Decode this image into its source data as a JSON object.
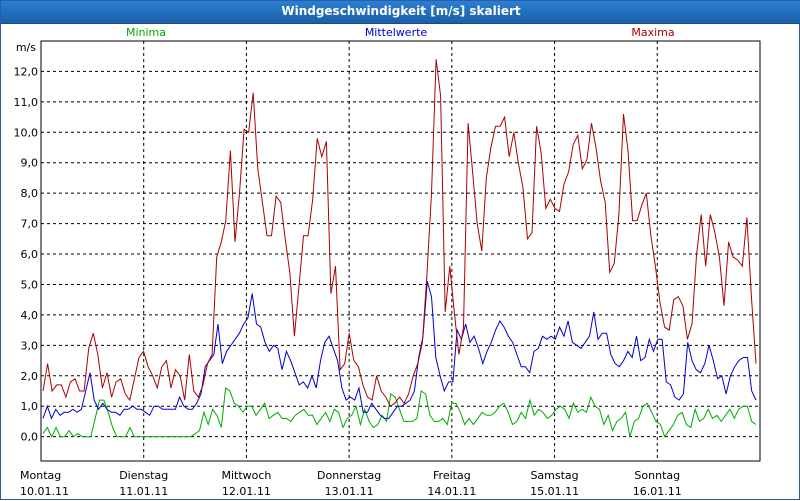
{
  "window": {
    "title": "Windgeschwindigkeit [m/s] skaliert"
  },
  "chart_data": {
    "type": "line",
    "title": "Windgeschwindigkeit [m/s] skaliert",
    "ylabel": "m/s",
    "ylim": [
      -0.8,
      13.0
    ],
    "y_ticks": [
      "0,0",
      "1,0",
      "2,0",
      "3,0",
      "4,0",
      "5,0",
      "6,0",
      "7,0",
      "8,0",
      "9,0",
      "10,0",
      "11,0",
      "12,0"
    ],
    "days": [
      {
        "name": "Montag",
        "date": "10.01.11"
      },
      {
        "name": "Dienstag",
        "date": "11.01.11"
      },
      {
        "name": "Mittwoch",
        "date": "12.01.11"
      },
      {
        "name": "Donnerstag",
        "date": "13.01.11"
      },
      {
        "name": "Freitag",
        "date": "14.01.11"
      },
      {
        "name": "Samstag",
        "date": "15.01.11"
      },
      {
        "name": "Sonntag",
        "date": "16.01.11"
      }
    ],
    "grid": true,
    "legend_position": "top",
    "series": [
      {
        "name": "Minima",
        "color": "#00aa00",
        "values": [
          0.1,
          0.3,
          0.0,
          0.3,
          0.0,
          0.0,
          0.2,
          0.0,
          0.1,
          0.0,
          0.0,
          0.0,
          0.6,
          1.2,
          1.2,
          0.8,
          0.3,
          0.0,
          0.0,
          0.0,
          0.3,
          0.0,
          0.0,
          0.0,
          0.0,
          0.0,
          0.0,
          0.0,
          0.0,
          0.0,
          0.0,
          0.0,
          0.0,
          0.0,
          0.0,
          0.1,
          0.2,
          0.8,
          0.4,
          0.9,
          0.7,
          0.3,
          1.6,
          1.5,
          1.1,
          1.0,
          0.8,
          1.0,
          1.0,
          0.7,
          0.9,
          1.1,
          0.6,
          0.7,
          0.8,
          0.6,
          0.6,
          0.5,
          0.7,
          0.8,
          0.9,
          0.7,
          0.7,
          0.4,
          0.6,
          0.8,
          0.5,
          0.9,
          0.8,
          0.3,
          0.6,
          0.7,
          1.0,
          0.4,
          0.9,
          0.5,
          0.3,
          0.4,
          0.7,
          0.5,
          1.4,
          1.3,
          0.9,
          0.5,
          0.5,
          0.5,
          0.6,
          1.5,
          1.4,
          0.7,
          0.5,
          0.5,
          0.6,
          0.4,
          1.1,
          1.1,
          0.8,
          0.4,
          0.6,
          0.4,
          0.6,
          0.8,
          0.7,
          0.7,
          0.8,
          1.0,
          1.1,
          0.8,
          0.4,
          0.5,
          0.8,
          0.6,
          1.2,
          0.7,
          0.9,
          0.8,
          0.6,
          0.7,
          0.9,
          1.0,
          0.9,
          0.6,
          1.1,
          0.8,
          0.9,
          0.8,
          1.3,
          1.0,
          0.9,
          0.4,
          0.7,
          0.2,
          0.5,
          0.6,
          0.8,
          0.0,
          0.5,
          0.6,
          1.0,
          1.1,
          0.8,
          0.5,
          0.4,
          0.0,
          0.2,
          0.4,
          0.7,
          0.8,
          0.4,
          0.3,
          0.9,
          0.5,
          0.6,
          0.9,
          0.6,
          0.7,
          0.5,
          0.7,
          0.9,
          0.6,
          0.9,
          1.0,
          1.0,
          0.5,
          0.4
        ]
      },
      {
        "name": "Mittelwerte",
        "color": "#0000cc",
        "values": [
          0.6,
          1.0,
          0.6,
          0.9,
          0.7,
          0.8,
          0.8,
          0.9,
          0.8,
          0.9,
          1.5,
          2.1,
          1.2,
          0.9,
          1.1,
          0.9,
          0.8,
          0.8,
          0.7,
          0.9,
          0.9,
          1.0,
          0.9,
          0.9,
          0.8,
          0.7,
          1.0,
          1.0,
          0.9,
          0.9,
          0.9,
          0.9,
          1.3,
          1.0,
          0.9,
          0.9,
          1.1,
          1.4,
          2.3,
          2.5,
          2.7,
          3.7,
          2.4,
          2.8,
          3.0,
          3.2,
          3.4,
          3.7,
          3.9,
          4.7,
          3.7,
          3.6,
          3.1,
          2.8,
          3.0,
          2.9,
          2.2,
          2.8,
          2.5,
          2.1,
          1.7,
          1.8,
          1.6,
          2.0,
          1.6,
          2.5,
          3.1,
          3.3,
          2.9,
          2.5,
          1.6,
          1.2,
          1.3,
          1.2,
          1.6,
          0.8,
          0.8,
          1.1,
          0.9,
          0.7,
          0.6,
          0.6,
          0.8,
          1.0,
          1.0,
          1.1,
          1.2,
          1.5,
          2.6,
          3.3,
          5.1,
          4.6,
          2.6,
          2.0,
          1.5,
          1.8,
          1.8,
          3.5,
          3.2,
          3.7,
          3.1,
          3.3,
          2.9,
          2.4,
          2.8,
          3.1,
          3.5,
          3.8,
          3.6,
          3.3,
          3.1,
          2.7,
          2.3,
          2.3,
          2.1,
          2.8,
          2.9,
          3.3,
          3.2,
          3.3,
          3.2,
          3.6,
          3.3,
          3.8,
          3.1,
          3.0,
          2.9,
          3.1,
          3.3,
          4.1,
          3.2,
          3.4,
          3.4,
          2.7,
          2.4,
          2.3,
          2.5,
          2.8,
          2.6,
          3.3,
          2.5,
          2.6,
          3.2,
          2.8,
          3.2,
          3.2,
          1.8,
          1.7,
          1.3,
          1.2,
          1.4,
          3.1,
          2.5,
          2.2,
          2.1,
          2.4,
          3.0,
          2.5,
          1.9,
          2.0,
          1.4,
          2.0,
          2.3,
          2.5,
          2.6,
          2.6,
          1.5,
          1.2
        ]
      },
      {
        "name": "Maxima",
        "color": "#aa0000",
        "values": [
          1.5,
          2.4,
          1.5,
          1.7,
          1.7,
          1.3,
          1.8,
          1.9,
          1.5,
          1.5,
          2.9,
          3.4,
          2.7,
          1.6,
          2.1,
          1.3,
          1.8,
          1.9,
          1.4,
          1.2,
          1.9,
          2.6,
          2.8,
          2.3,
          2.0,
          1.6,
          2.3,
          2.5,
          1.6,
          2.2,
          2.0,
          1.2,
          2.7,
          1.5,
          1.3,
          1.7,
          2.4,
          2.7,
          5.9,
          6.4,
          7.1,
          9.4,
          6.4,
          8.0,
          10.1,
          10.0,
          11.3,
          8.8,
          7.7,
          6.6,
          6.6,
          7.9,
          7.7,
          6.5,
          5.4,
          3.3,
          4.9,
          6.6,
          6.6,
          7.8,
          9.8,
          9.2,
          9.7,
          4.7,
          5.6,
          2.2,
          2.4,
          3.4,
          2.5,
          2.3,
          1.7,
          1.3,
          1.2,
          2.0,
          1.5,
          1.3,
          1.0,
          1.1,
          1.3,
          1.1,
          1.4,
          2.0,
          2.4,
          3.1,
          5.3,
          8.0,
          12.4,
          11.2,
          4.1,
          5.6,
          4.1,
          2.7,
          3.6,
          10.3,
          8.7,
          7.0,
          6.1,
          8.5,
          9.5,
          10.2,
          10.2,
          10.5,
          9.2,
          10.0,
          9.0,
          8.2,
          6.5,
          6.7,
          10.2,
          9.3,
          7.5,
          7.8,
          7.5,
          7.4,
          8.3,
          8.7,
          9.6,
          9.9,
          8.8,
          9.1,
          10.3,
          9.5,
          8.4,
          7.7,
          5.4,
          5.7,
          7.3,
          10.6,
          9.4,
          7.1,
          7.1,
          7.6,
          8.0,
          6.6,
          5.6,
          4.4,
          3.6,
          3.5,
          4.5,
          4.6,
          4.3,
          3.2,
          3.7,
          6.0,
          7.3,
          5.6,
          7.3,
          6.7,
          5.9,
          4.3,
          6.4,
          5.9,
          5.8,
          5.6,
          7.2,
          4.6,
          2.4
        ]
      }
    ]
  }
}
